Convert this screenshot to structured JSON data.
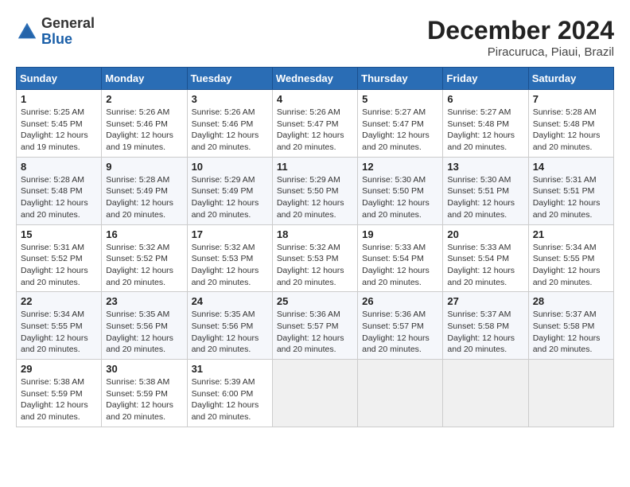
{
  "logo": {
    "general": "General",
    "blue": "Blue"
  },
  "title": "December 2024",
  "subtitle": "Piracuruca, Piaui, Brazil",
  "days_header": [
    "Sunday",
    "Monday",
    "Tuesday",
    "Wednesday",
    "Thursday",
    "Friday",
    "Saturday"
  ],
  "weeks": [
    [
      {
        "num": "1",
        "info": "Sunrise: 5:25 AM\nSunset: 5:45 PM\nDaylight: 12 hours\nand 19 minutes."
      },
      {
        "num": "2",
        "info": "Sunrise: 5:26 AM\nSunset: 5:46 PM\nDaylight: 12 hours\nand 19 minutes."
      },
      {
        "num": "3",
        "info": "Sunrise: 5:26 AM\nSunset: 5:46 PM\nDaylight: 12 hours\nand 20 minutes."
      },
      {
        "num": "4",
        "info": "Sunrise: 5:26 AM\nSunset: 5:47 PM\nDaylight: 12 hours\nand 20 minutes."
      },
      {
        "num": "5",
        "info": "Sunrise: 5:27 AM\nSunset: 5:47 PM\nDaylight: 12 hours\nand 20 minutes."
      },
      {
        "num": "6",
        "info": "Sunrise: 5:27 AM\nSunset: 5:48 PM\nDaylight: 12 hours\nand 20 minutes."
      },
      {
        "num": "7",
        "info": "Sunrise: 5:28 AM\nSunset: 5:48 PM\nDaylight: 12 hours\nand 20 minutes."
      }
    ],
    [
      {
        "num": "8",
        "info": "Sunrise: 5:28 AM\nSunset: 5:48 PM\nDaylight: 12 hours\nand 20 minutes."
      },
      {
        "num": "9",
        "info": "Sunrise: 5:28 AM\nSunset: 5:49 PM\nDaylight: 12 hours\nand 20 minutes."
      },
      {
        "num": "10",
        "info": "Sunrise: 5:29 AM\nSunset: 5:49 PM\nDaylight: 12 hours\nand 20 minutes."
      },
      {
        "num": "11",
        "info": "Sunrise: 5:29 AM\nSunset: 5:50 PM\nDaylight: 12 hours\nand 20 minutes."
      },
      {
        "num": "12",
        "info": "Sunrise: 5:30 AM\nSunset: 5:50 PM\nDaylight: 12 hours\nand 20 minutes."
      },
      {
        "num": "13",
        "info": "Sunrise: 5:30 AM\nSunset: 5:51 PM\nDaylight: 12 hours\nand 20 minutes."
      },
      {
        "num": "14",
        "info": "Sunrise: 5:31 AM\nSunset: 5:51 PM\nDaylight: 12 hours\nand 20 minutes."
      }
    ],
    [
      {
        "num": "15",
        "info": "Sunrise: 5:31 AM\nSunset: 5:52 PM\nDaylight: 12 hours\nand 20 minutes."
      },
      {
        "num": "16",
        "info": "Sunrise: 5:32 AM\nSunset: 5:52 PM\nDaylight: 12 hours\nand 20 minutes."
      },
      {
        "num": "17",
        "info": "Sunrise: 5:32 AM\nSunset: 5:53 PM\nDaylight: 12 hours\nand 20 minutes."
      },
      {
        "num": "18",
        "info": "Sunrise: 5:32 AM\nSunset: 5:53 PM\nDaylight: 12 hours\nand 20 minutes."
      },
      {
        "num": "19",
        "info": "Sunrise: 5:33 AM\nSunset: 5:54 PM\nDaylight: 12 hours\nand 20 minutes."
      },
      {
        "num": "20",
        "info": "Sunrise: 5:33 AM\nSunset: 5:54 PM\nDaylight: 12 hours\nand 20 minutes."
      },
      {
        "num": "21",
        "info": "Sunrise: 5:34 AM\nSunset: 5:55 PM\nDaylight: 12 hours\nand 20 minutes."
      }
    ],
    [
      {
        "num": "22",
        "info": "Sunrise: 5:34 AM\nSunset: 5:55 PM\nDaylight: 12 hours\nand 20 minutes."
      },
      {
        "num": "23",
        "info": "Sunrise: 5:35 AM\nSunset: 5:56 PM\nDaylight: 12 hours\nand 20 minutes."
      },
      {
        "num": "24",
        "info": "Sunrise: 5:35 AM\nSunset: 5:56 PM\nDaylight: 12 hours\nand 20 minutes."
      },
      {
        "num": "25",
        "info": "Sunrise: 5:36 AM\nSunset: 5:57 PM\nDaylight: 12 hours\nand 20 minutes."
      },
      {
        "num": "26",
        "info": "Sunrise: 5:36 AM\nSunset: 5:57 PM\nDaylight: 12 hours\nand 20 minutes."
      },
      {
        "num": "27",
        "info": "Sunrise: 5:37 AM\nSunset: 5:58 PM\nDaylight: 12 hours\nand 20 minutes."
      },
      {
        "num": "28",
        "info": "Sunrise: 5:37 AM\nSunset: 5:58 PM\nDaylight: 12 hours\nand 20 minutes."
      }
    ],
    [
      {
        "num": "29",
        "info": "Sunrise: 5:38 AM\nSunset: 5:59 PM\nDaylight: 12 hours\nand 20 minutes."
      },
      {
        "num": "30",
        "info": "Sunrise: 5:38 AM\nSunset: 5:59 PM\nDaylight: 12 hours\nand 20 minutes."
      },
      {
        "num": "31",
        "info": "Sunrise: 5:39 AM\nSunset: 6:00 PM\nDaylight: 12 hours\nand 20 minutes."
      },
      {
        "num": "",
        "info": ""
      },
      {
        "num": "",
        "info": ""
      },
      {
        "num": "",
        "info": ""
      },
      {
        "num": "",
        "info": ""
      }
    ]
  ]
}
